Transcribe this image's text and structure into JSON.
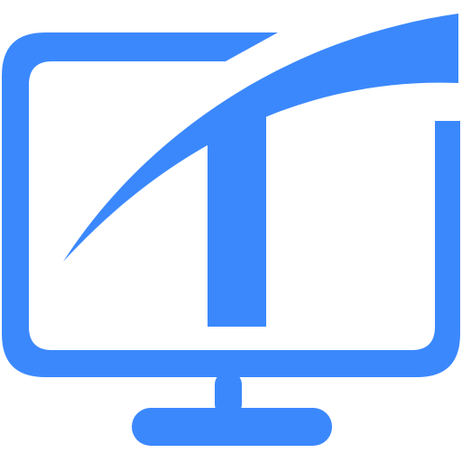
{
  "logo": {
    "icon_name": "monitor-t-logo-icon",
    "primary_color": "#3b88fd",
    "background_color": "#ffffff"
  }
}
